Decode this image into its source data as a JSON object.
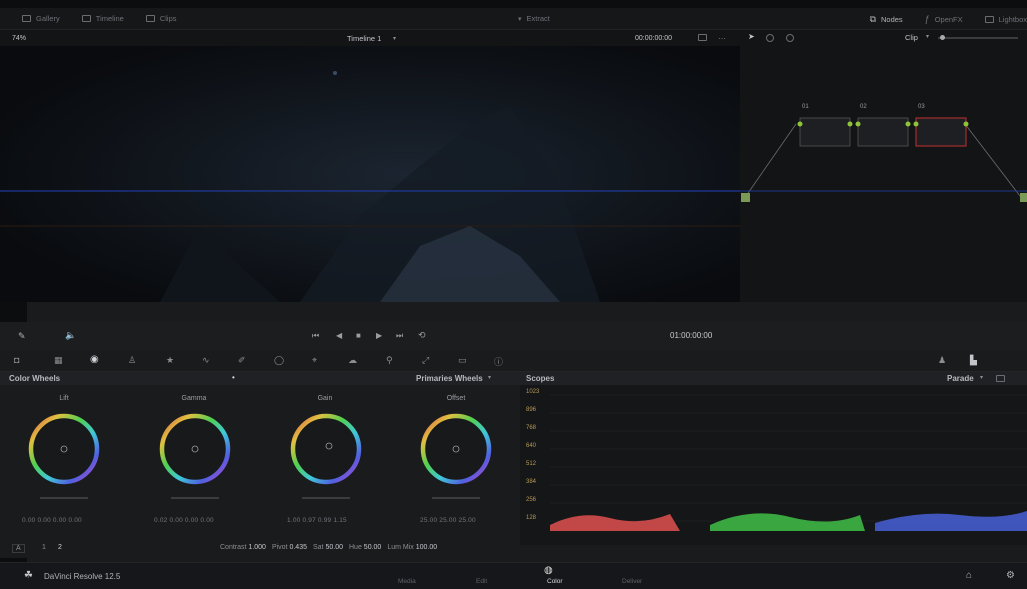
{
  "topbar": {
    "left_items": [
      "Gallery",
      "Timeline",
      "Clips"
    ],
    "center_item": "Extract",
    "right_items": [
      "Nodes",
      "OpenFX",
      "Lightbox"
    ]
  },
  "viewer": {
    "zoom": "74%",
    "timeline_name": "Timeline 1",
    "timecode": "00:00:00:00"
  },
  "node_editor": {
    "mode": "Clip",
    "nodes": [
      "01",
      "02",
      "03"
    ]
  },
  "transport": {
    "timecode": "01:00:00:00"
  },
  "color_wheels": {
    "panel_title": "Color Wheels",
    "mode": "Primaries Wheels",
    "wheels": [
      {
        "label": "Lift",
        "values": "0.00  0.00  0.00  0.00"
      },
      {
        "label": "Gamma",
        "values": "0.02  0.00  0.00  0.00"
      },
      {
        "label": "Gain",
        "values": "1.00  0.97  0.99  1.15"
      },
      {
        "label": "Offset",
        "values": "25.00  25.00  25.00"
      }
    ],
    "pages": [
      "1",
      "2"
    ],
    "params": [
      {
        "label": "Contrast",
        "value": "1.000"
      },
      {
        "label": "Pivot",
        "value": "0.435"
      },
      {
        "label": "Sat",
        "value": "50.00"
      },
      {
        "label": "Hue",
        "value": "50.00"
      },
      {
        "label": "Lum Mix",
        "value": "100.00"
      }
    ]
  },
  "scopes": {
    "panel_title": "Scopes",
    "mode": "Parade",
    "ticks": [
      "1023",
      "896",
      "768",
      "640",
      "512",
      "384",
      "256",
      "128"
    ]
  },
  "statusbar": {
    "app_name": "DaVinci Resolve 12.5",
    "pages": [
      "Media",
      "Edit",
      "Color",
      "Deliver"
    ],
    "active_page": "Color"
  }
}
